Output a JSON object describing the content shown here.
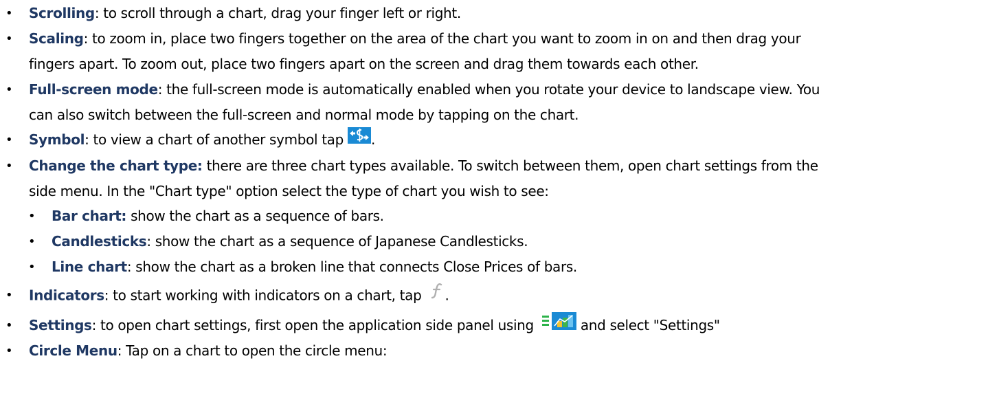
{
  "items": [
    {
      "term": "Scrolling",
      "text": ":  to scroll through a chart, drag your finger left or right."
    },
    {
      "term": "Scaling",
      "text": ": to zoom in, place two fingers together on the area of the chart you want to zoom in on and then drag your",
      "text2": "fingers apart. To zoom out, place two fingers apart on the screen and drag them towards each other."
    },
    {
      "term": "Full-screen mode",
      "text": ": the full-screen mode is automatically enabled when you rotate your device to landscape view. You",
      "text2": "can also switch between the full-screen and normal mode by tapping on the chart."
    },
    {
      "term": "Symbol",
      "text": ": to view a chart of another symbol tap",
      "after_icon": "."
    },
    {
      "term": "Change the chart type:",
      "text": " there are three chart types available. To switch between them, open chart settings from the",
      "text2": "side menu. In the \"Chart type\" option select the type of chart you wish to see:"
    },
    {
      "term": "Indicators",
      "text": ": to start working with indicators on a chart, tap",
      "after_icon": "."
    },
    {
      "term": "Settings",
      "text": ": to open chart settings, first open the application side panel using",
      "after_icon": " and select \"Settings\""
    },
    {
      "term": "Circle Menu",
      "text": ": Tap on a chart to open the circle menu:"
    }
  ],
  "subitems": [
    {
      "term": "Bar chart:",
      "text": " show the chart as a sequence of bars."
    },
    {
      "term": "Candlesticks",
      "text": ": show the chart as a sequence of Japanese Candlesticks."
    },
    {
      "term": "Line chart",
      "text": ": show the chart as a broken line that connects Close Prices of bars."
    }
  ],
  "bullet": "•",
  "icons": {
    "symbol": "symbol-switch-icon",
    "indicators": "function-icon",
    "side_panel": "side-panel-menu-icon"
  },
  "colors": {
    "term": "#1f3863",
    "icon_blue": "#1a8ad4"
  }
}
